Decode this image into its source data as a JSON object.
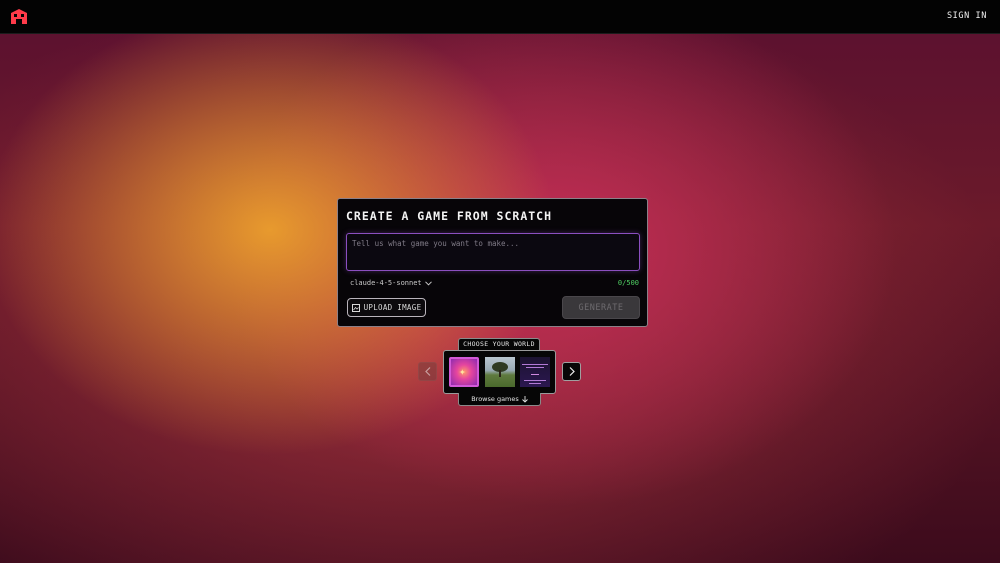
{
  "header": {
    "logo_icon": "game-controller-logo",
    "sign_in_label": "SIGN IN"
  },
  "create_card": {
    "title": "CREATE A GAME FROM SCRATCH",
    "prompt_placeholder": "Tell us what game you want to make...",
    "prompt_value": "",
    "model_selected": "claude-4-5-sonnet",
    "char_counter": "0/500",
    "upload_label": "UPLOAD IMAGE",
    "generate_label": "GENERATE",
    "accent_color": "#8b4fc0",
    "counter_color": "#4fcf63"
  },
  "world_picker": {
    "label": "CHOOSE YOUR WORLD",
    "browse_label": "Browse games",
    "thumbnails": [
      "sparkle-world",
      "tree-landscape-world",
      "text-title-world"
    ]
  }
}
